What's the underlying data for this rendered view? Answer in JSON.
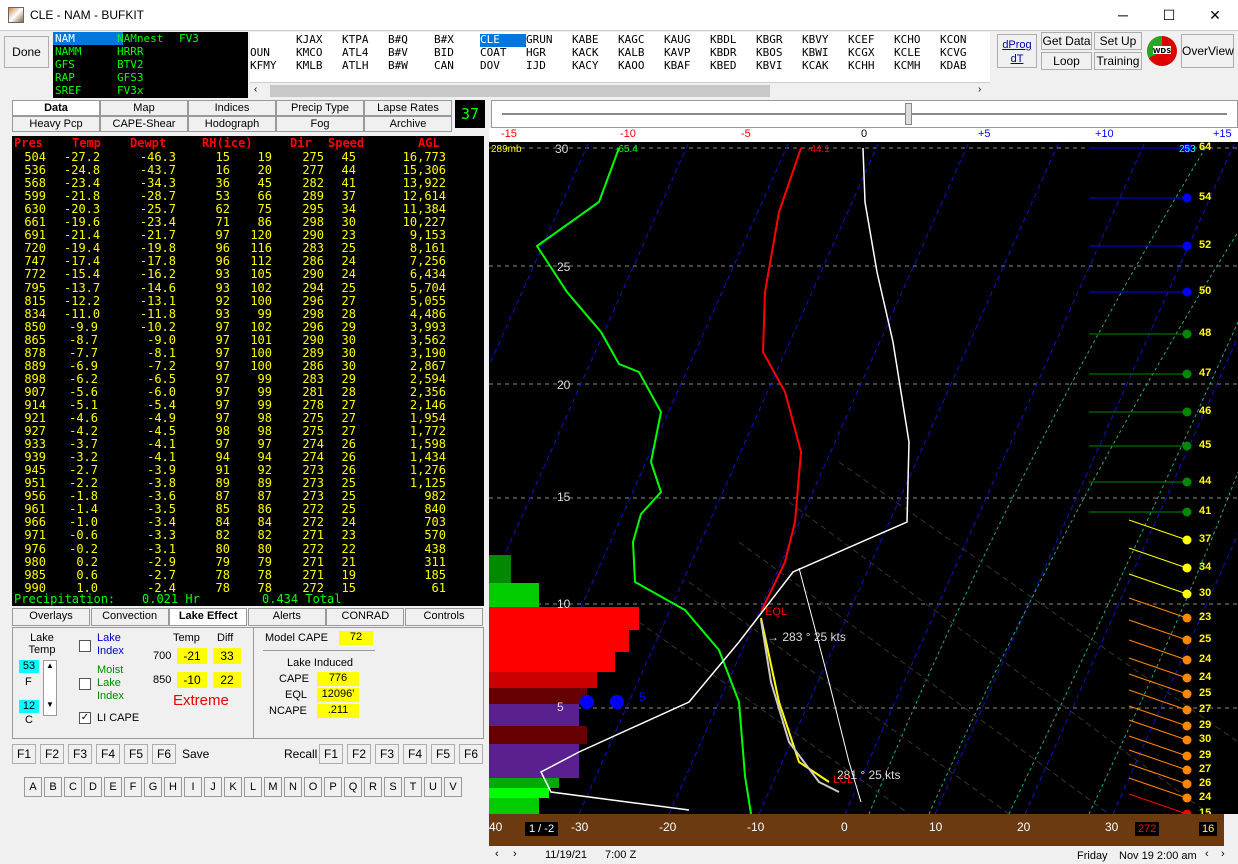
{
  "window": {
    "title": "CLE - NAM - BUFKIT",
    "minimize": "─",
    "maximize": "☐",
    "close": "✕"
  },
  "toolbar": {
    "done": "Done",
    "dprog_1": "dProg",
    "dprog_2": "dT",
    "get_data": "Get Data",
    "set_up": "Set Up",
    "loop": "Loop",
    "training": "Training",
    "overview": "OverView"
  },
  "models": [
    [
      "NAM",
      "NAMM",
      "GFS",
      "RAP",
      "SREF"
    ],
    [
      "NAMnest",
      "HRRR",
      "BTV2",
      "GFS3",
      "FV3x"
    ],
    [
      "FV3",
      "",
      "",
      "",
      ""
    ]
  ],
  "stations": [
    [
      "",
      "OUN",
      "KFMY"
    ],
    [
      "KJAX",
      "KMCO",
      "KMLB"
    ],
    [
      "KTPA",
      "ATL4",
      "ATLH"
    ],
    [
      "B#Q",
      "B#V",
      "B#W"
    ],
    [
      "B#X",
      "BID",
      "CAN"
    ],
    [
      "CLE",
      "COAT",
      "DOV"
    ],
    [
      "GRUN",
      "HGR",
      "IJD"
    ],
    [
      "KABE",
      "KACK",
      "KACY"
    ],
    [
      "KAGC",
      "KALB",
      "KAOO"
    ],
    [
      "KAUG",
      "KAVP",
      "KBAF"
    ],
    [
      "KBDL",
      "KBDR",
      "KBED"
    ],
    [
      "KBGR",
      "KBOS",
      "KBVI"
    ],
    [
      "KBVY",
      "KBWI",
      "KCAK"
    ],
    [
      "KCEF",
      "KCGX",
      "KCHH"
    ],
    [
      "KCHO",
      "KCLE",
      "KCMH"
    ],
    [
      "KCON",
      "KCVG",
      "KDAB"
    ]
  ],
  "tabs_top": [
    "Data",
    "Map",
    "Indices",
    "Precip Type",
    "Lapse Rates",
    "Heavy Pcp",
    "CAPE-Shear",
    "Hodograph",
    "Fog",
    "Archive"
  ],
  "frame_count": "37",
  "table": {
    "headers": [
      "Pres",
      "Temp",
      "Dewpt",
      "RH(ice)",
      "Dir",
      "Speed",
      "AGL"
    ],
    "rows": [
      [
        "504",
        "-27.2",
        "-46.3",
        "15",
        "19",
        "275",
        "45",
        "16,773"
      ],
      [
        "536",
        "-24.8",
        "-43.7",
        "16",
        "20",
        "277",
        "44",
        "15,306"
      ],
      [
        "568",
        "-23.4",
        "-34.3",
        "36",
        "45",
        "282",
        "41",
        "13,922"
      ],
      [
        "599",
        "-21.8",
        "-28.7",
        "53",
        "66",
        "289",
        "37",
        "12,614"
      ],
      [
        "630",
        "-20.3",
        "-25.7",
        "62",
        "75",
        "295",
        "34",
        "11,384"
      ],
      [
        "661",
        "-19.6",
        "-23.4",
        "71",
        "86",
        "298",
        "30",
        "10,227"
      ],
      [
        "691",
        "-21.4",
        "-21.7",
        "97",
        "120",
        "290",
        "23",
        "9,153"
      ],
      [
        "720",
        "-19.4",
        "-19.8",
        "96",
        "116",
        "283",
        "25",
        "8,161"
      ],
      [
        "747",
        "-17.4",
        "-17.8",
        "96",
        "112",
        "286",
        "24",
        "7,256"
      ],
      [
        "772",
        "-15.4",
        "-16.2",
        "93",
        "105",
        "290",
        "24",
        "6,434"
      ],
      [
        "795",
        "-13.7",
        "-14.6",
        "93",
        "102",
        "294",
        "25",
        "5,704"
      ],
      [
        "815",
        "-12.2",
        "-13.1",
        "92",
        "100",
        "296",
        "27",
        "5,055"
      ],
      [
        "834",
        "-11.0",
        "-11.8",
        "93",
        "99",
        "298",
        "28",
        "4,486"
      ],
      [
        "850",
        "-9.9",
        "-10.2",
        "97",
        "102",
        "296",
        "29",
        "3,993"
      ],
      [
        "865",
        "-8.7",
        "-9.0",
        "97",
        "101",
        "290",
        "30",
        "3,562"
      ],
      [
        "878",
        "-7.7",
        "-8.1",
        "97",
        "100",
        "289",
        "30",
        "3,190"
      ],
      [
        "889",
        "-6.9",
        "-7.2",
        "97",
        "100",
        "286",
        "30",
        "2,867"
      ],
      [
        "898",
        "-6.2",
        "-6.5",
        "97",
        "99",
        "283",
        "29",
        "2,594"
      ],
      [
        "907",
        "-5.6",
        "-6.0",
        "97",
        "99",
        "281",
        "28",
        "2,356"
      ],
      [
        "914",
        "-5.1",
        "-5.4",
        "97",
        "99",
        "278",
        "27",
        "2,146"
      ],
      [
        "921",
        "-4.6",
        "-4.9",
        "97",
        "98",
        "275",
        "27",
        "1,954"
      ],
      [
        "927",
        "-4.2",
        "-4.5",
        "98",
        "98",
        "275",
        "27",
        "1,772"
      ],
      [
        "933",
        "-3.7",
        "-4.1",
        "97",
        "97",
        "274",
        "26",
        "1,598"
      ],
      [
        "939",
        "-3.2",
        "-4.1",
        "94",
        "94",
        "274",
        "26",
        "1,434"
      ],
      [
        "945",
        "-2.7",
        "-3.9",
        "91",
        "92",
        "273",
        "26",
        "1,276"
      ],
      [
        "951",
        "-2.2",
        "-3.8",
        "89",
        "89",
        "273",
        "25",
        "1,125"
      ],
      [
        "956",
        "-1.8",
        "-3.6",
        "87",
        "87",
        "273",
        "25",
        "982"
      ],
      [
        "961",
        "-1.4",
        "-3.5",
        "85",
        "86",
        "272",
        "25",
        "840"
      ],
      [
        "966",
        "-1.0",
        "-3.4",
        "84",
        "84",
        "272",
        "24",
        "703"
      ],
      [
        "971",
        "-0.6",
        "-3.3",
        "82",
        "82",
        "271",
        "23",
        "570"
      ],
      [
        "976",
        "-0.2",
        "-3.1",
        "80",
        "80",
        "272",
        "22",
        "438"
      ],
      [
        "980",
        "0.2",
        "-2.9",
        "79",
        "79",
        "271",
        "21",
        "311"
      ],
      [
        "985",
        "0.6",
        "-2.7",
        "78",
        "78",
        "271",
        "19",
        "185"
      ],
      [
        "990",
        "1.0",
        "-2.4",
        "78",
        "78",
        "272",
        "15",
        "61"
      ]
    ],
    "footer_label": "Precipitation:",
    "footer_hr": "0.021 Hr",
    "footer_total": "0.434 Total"
  },
  "tabs_mid": [
    "Overlays",
    "Convection",
    "Lake Effect",
    "Alerts",
    "CONRAD",
    "Controls"
  ],
  "lake": {
    "lake_temp_label": "Lake Temp",
    "temp_f": "53",
    "unit_f": "F",
    "temp_c": "12",
    "unit_c": "C",
    "lake_index_label": "Lake Index",
    "moist_label": "Moist Lake Index",
    "li_cape_label": "LI CAPE",
    "temp_hdr": "Temp",
    "diff_hdr": "Diff",
    "p700": "700",
    "t700": "-21",
    "d700": "33",
    "p850": "850",
    "t850": "-10",
    "d850": "22",
    "rating": "Extreme",
    "model_cape_label": "Model CAPE",
    "model_cape": "72",
    "lake_induced": "Lake Induced",
    "cape_label": "CAPE",
    "cape": "776",
    "eql_label": "EQL",
    "eql": "12096'",
    "ncape_label": "NCAPE",
    "ncape": ".211"
  },
  "fkeys_left": [
    "F1",
    "F2",
    "F3",
    "F4",
    "F5",
    "F6"
  ],
  "save": "Save",
  "recall": "Recall",
  "fkeys_right": [
    "F1",
    "F2",
    "F3",
    "F4",
    "F5",
    "F6"
  ],
  "letters": [
    "A",
    "B",
    "C",
    "D",
    "E",
    "F",
    "G",
    "H",
    "I",
    "J",
    "K",
    "L",
    "M",
    "N",
    "O",
    "P",
    "Q",
    "R",
    "S",
    "T",
    "U",
    "V"
  ],
  "skewt": {
    "top_axis": [
      "-15",
      "-10",
      "-5",
      "0",
      "+5",
      "+10",
      "+15"
    ],
    "height_labels": [
      "30",
      "25",
      "20",
      "15",
      "10",
      "5"
    ],
    "bottom_axis": [
      "40",
      "-30",
      "-20",
      "-10",
      "0",
      "10",
      "20",
      "30"
    ],
    "top_left_label": "289mb",
    "top_val": "-65.4",
    "top_right_val": "-44.1",
    "top_right_label": "253",
    "eql_label": "EQL",
    "wind1": "283 ° 25 kts",
    "wind2": "281 ° 25 kts",
    "lcl": "LCL",
    "five": "5",
    "bottom_left_box": "1 / -2",
    "bottom_right_box": "272",
    "bottom_right_val": "16",
    "wind_dots": [
      [
        "64",
        "#00f"
      ],
      [
        "54",
        "#00f"
      ],
      [
        "52",
        "#00f"
      ],
      [
        "50",
        "#00f"
      ],
      [
        "48",
        "#080"
      ],
      [
        "47",
        "#080"
      ],
      [
        "46",
        "#080"
      ],
      [
        "45",
        "#080"
      ],
      [
        "44",
        "#080"
      ],
      [
        "41",
        "#080"
      ],
      [
        "37",
        "#ff0"
      ],
      [
        "34",
        "#ff0"
      ],
      [
        "30",
        "#ff0"
      ],
      [
        "23",
        "#f80"
      ],
      [
        "25",
        "#f80"
      ],
      [
        "24",
        "#f80"
      ],
      [
        "24",
        "#f80"
      ],
      [
        "25",
        "#f80"
      ],
      [
        "27",
        "#f80"
      ],
      [
        "29",
        "#f80"
      ],
      [
        "30",
        "#f80"
      ],
      [
        "29",
        "#f80"
      ],
      [
        "27",
        "#f80"
      ],
      [
        "26",
        "#f80"
      ],
      [
        "24",
        "#f80"
      ],
      [
        "15",
        "#f00"
      ]
    ]
  },
  "status": {
    "date": "11/19/21",
    "time": "7:00 Z",
    "day": "Friday",
    "valid": "Nov 19  2:00 am"
  }
}
